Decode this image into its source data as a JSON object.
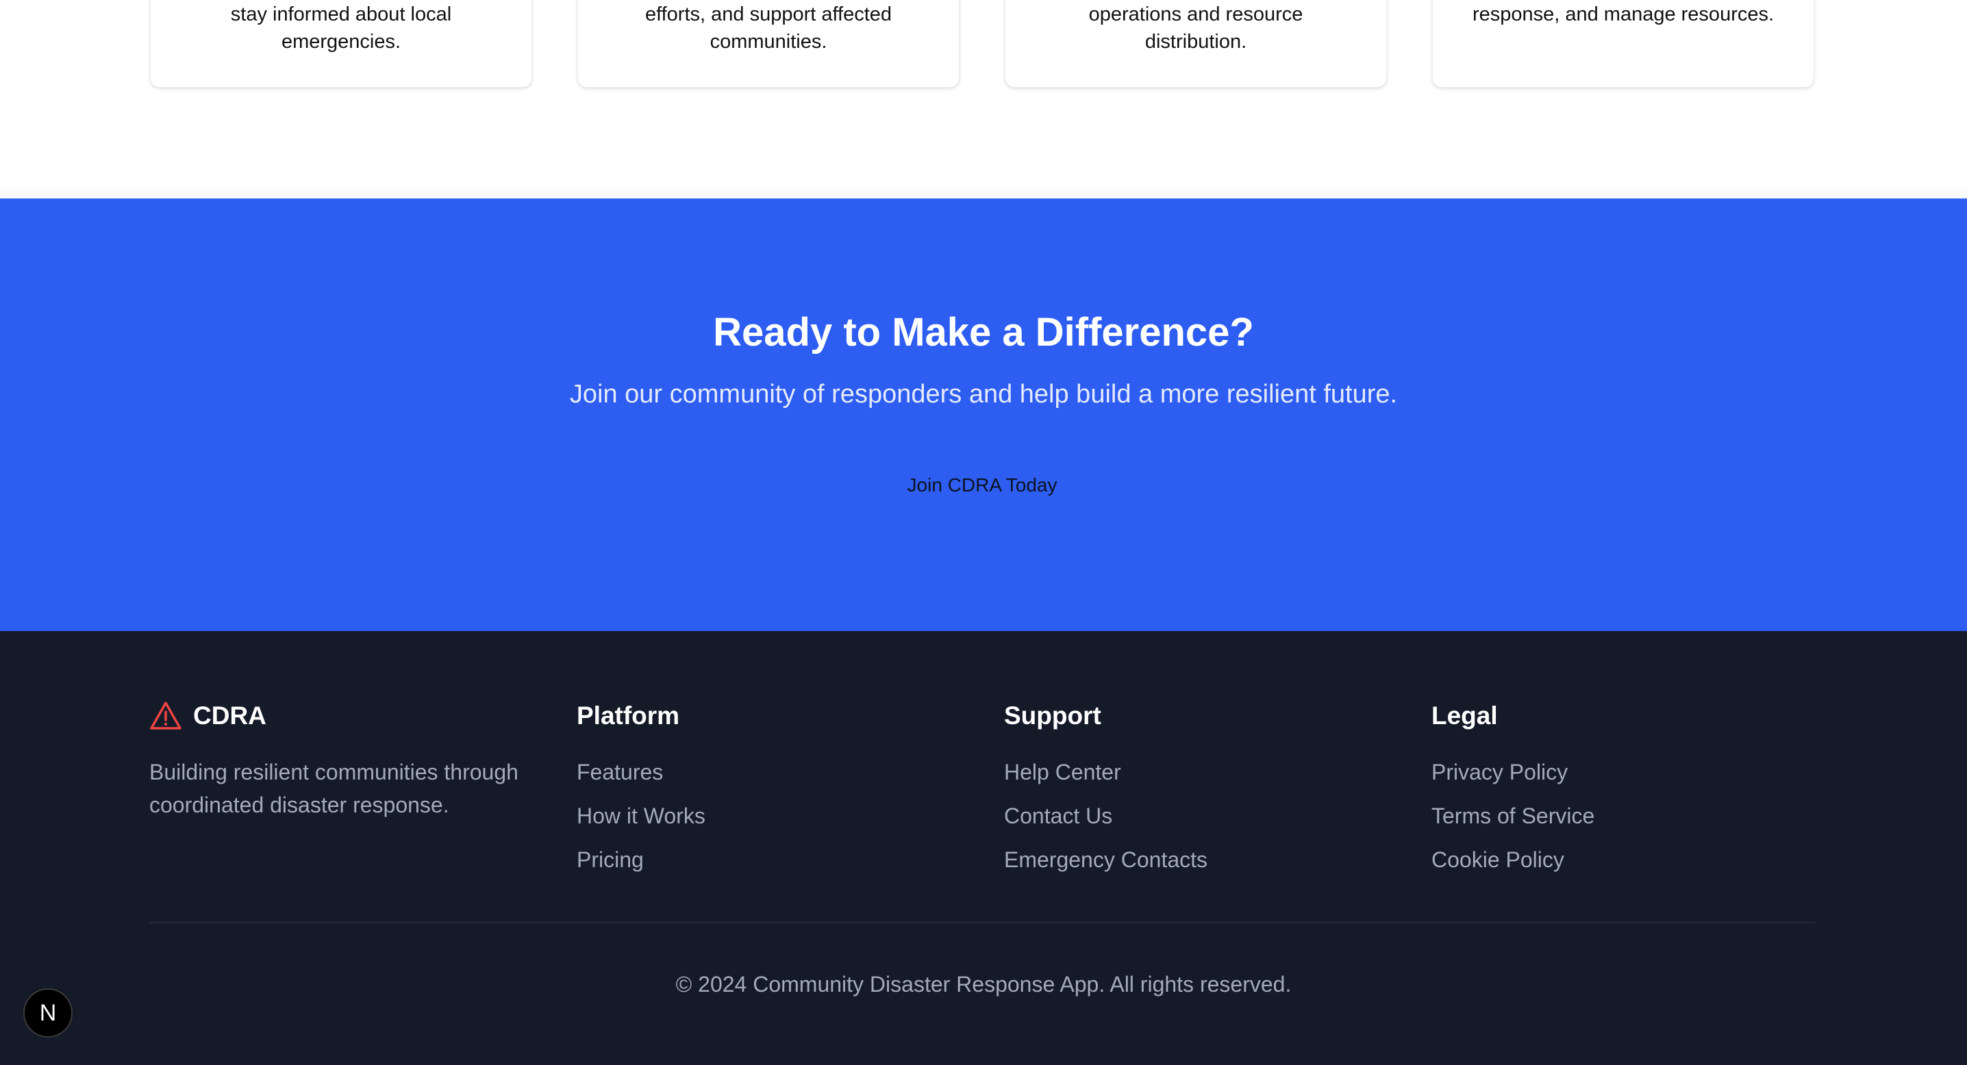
{
  "features": {
    "cards": [
      {
        "desc_line1": "stay informed about local",
        "desc_line2": "emergencies."
      },
      {
        "desc_line1": "efforts, and support affected",
        "desc_line2": "communities."
      },
      {
        "desc_line1": "operations and resource",
        "desc_line2": "distribution."
      },
      {
        "desc_line1": "response, and manage resources.",
        "desc_line2": ""
      }
    ]
  },
  "cta": {
    "title": "Ready to Make a Difference?",
    "subtitle": "Join our community of responders and help build a more resilient future.",
    "button_label": "Join CDRA Today",
    "background_color": "#2d5df1"
  },
  "footer": {
    "brand": {
      "name": "CDRA",
      "icon": "warning-triangle-icon",
      "icon_color": "#ef4444",
      "description": "Building resilient communities through coordinated disaster response."
    },
    "columns": [
      {
        "heading": "Platform",
        "links": [
          "Features",
          "How it Works",
          "Pricing"
        ]
      },
      {
        "heading": "Support",
        "links": [
          "Help Center",
          "Contact Us",
          "Emergency Contacts"
        ]
      },
      {
        "heading": "Legal",
        "links": [
          "Privacy Policy",
          "Terms of Service",
          "Cookie Policy"
        ]
      }
    ],
    "copyright": "© 2024 Community Disaster Response App. All rights reserved.",
    "background_color": "#141a28"
  },
  "dev_badge": {
    "label": "N",
    "icon": "nextjs-logo-icon"
  }
}
